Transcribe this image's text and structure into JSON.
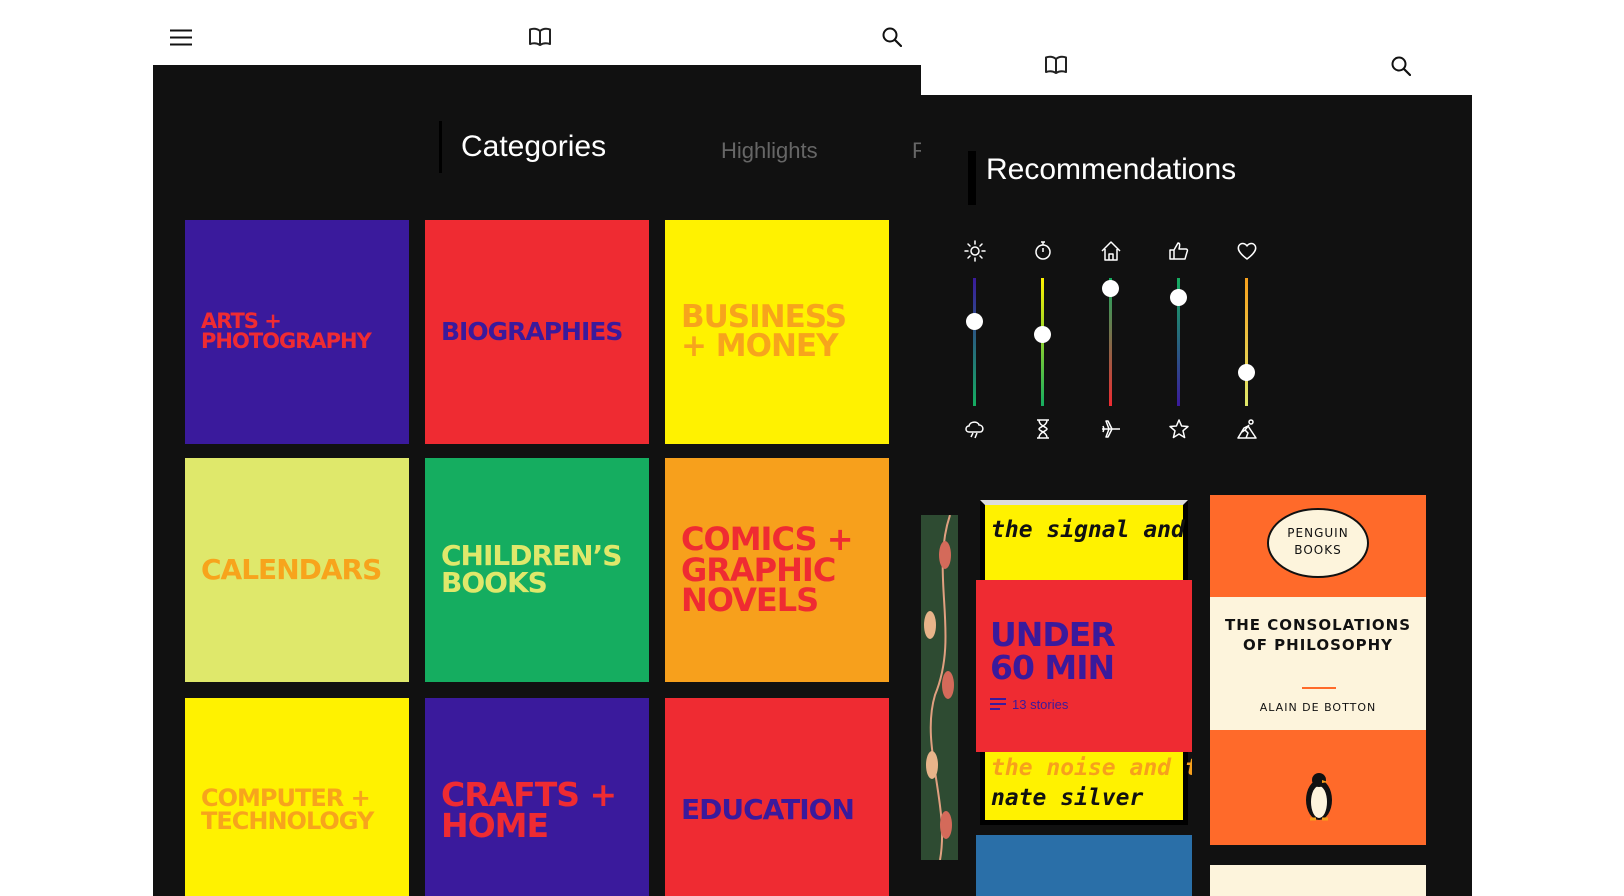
{
  "left_screen": {
    "tabs": [
      {
        "label": "Categories",
        "active": true
      },
      {
        "label": "Highlights",
        "active": false
      },
      {
        "label": "R",
        "active": false
      }
    ],
    "categories": [
      {
        "label": "ARTS + PHOTOGRAPHY",
        "bg": "#3a1a9c",
        "fg": "#ef2b32"
      },
      {
        "label": "BIOGRAPHIES",
        "bg": "#ef2b32",
        "fg": "#3a1a9c"
      },
      {
        "label": "BUSINESS + MONEY",
        "bg": "#fff200",
        "fg": "#f7a41c"
      },
      {
        "label": "CALENDARS",
        "bg": "#dfe86b",
        "fg": "#f7a41c"
      },
      {
        "label": "CHILDREN’S BOOKS",
        "bg": "#15ad60",
        "fg": "#dfe86b"
      },
      {
        "label": "COMICS + GRAPHIC NOVELS",
        "bg": "#f7a01c",
        "fg": "#ef2b32"
      },
      {
        "label": "COMPUTER + TECHNOLOGY",
        "bg": "#fff200",
        "fg": "#f7a41c"
      },
      {
        "label": "CRAFTS + HOME",
        "bg": "#3a1a9c",
        "fg": "#ef2b32"
      },
      {
        "label": "EDUCATION",
        "bg": "#ef2b32",
        "fg": "#3a1a9c"
      }
    ]
  },
  "right_screen": {
    "title": "Recommendations",
    "sliders": [
      {
        "top_icon": "sun-icon",
        "bottom_icon": "storm-cloud-icon",
        "value": 0.66
      },
      {
        "top_icon": "stopwatch-icon",
        "bottom_icon": "hourglass-icon",
        "value": 0.56
      },
      {
        "top_icon": "house-icon",
        "bottom_icon": "airplane-icon",
        "value": 0.92
      },
      {
        "top_icon": "thumbs-up-icon",
        "bottom_icon": "star-icon",
        "value": 0.85
      },
      {
        "top_icon": "heart-icon",
        "bottom_icon": "hiking-icon",
        "value": 0.26
      }
    ],
    "playlist": {
      "cover_lines": [
        "the signal and the noise",
        "the noise and the",
        "nate silver"
      ],
      "title": "UNDER 60 MIN",
      "count": "13 stories"
    },
    "penguin": {
      "publisher": "PENGUIN BOOKS",
      "title": "THE CONSOLATIONS OF PHILOSOPHY",
      "author": "ALAIN DE BOTTON"
    }
  },
  "colors": {
    "dark_bg": "#111111",
    "purple": "#3a1a9c",
    "red": "#ef2b32",
    "yellow": "#fff200",
    "green": "#15ad60",
    "orange": "#f7a01c",
    "lime": "#dfe86b"
  }
}
